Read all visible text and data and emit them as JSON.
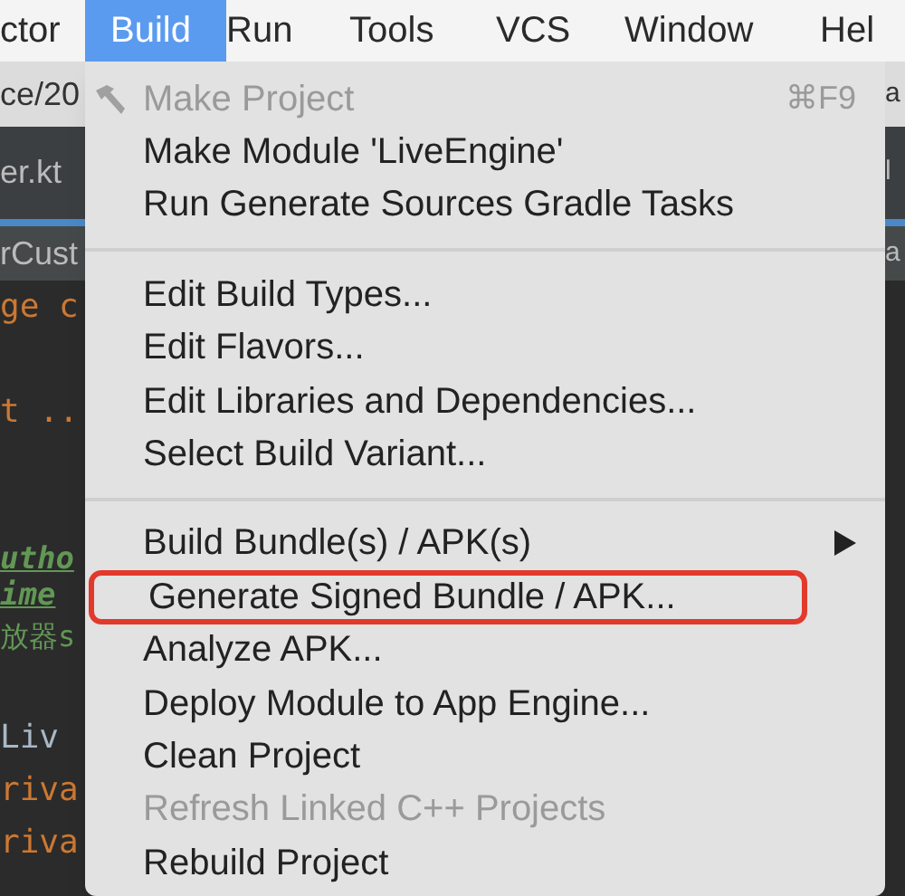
{
  "menu_bar": [
    {
      "label": "ctor",
      "selected": false
    },
    {
      "label": "Build",
      "selected": true
    },
    {
      "label": "Run",
      "selected": false
    },
    {
      "label": "Tools",
      "selected": false
    },
    {
      "label": "VCS",
      "selected": false
    },
    {
      "label": "Window",
      "selected": false
    },
    {
      "label": "Hel",
      "selected": false
    }
  ],
  "editor_left": [
    {
      "kind": "path",
      "text": "ce/20"
    },
    {
      "kind": "tab",
      "text": "er.kt"
    },
    {
      "kind": "tab2",
      "text": "rCust"
    },
    {
      "kind": "keyword",
      "text": "ge c"
    },
    {
      "kind": "blank"
    },
    {
      "kind": "keyword",
      "text": "t .."
    },
    {
      "kind": "blank"
    },
    {
      "kind": "blank"
    },
    {
      "kind": "doc",
      "text": "utho"
    },
    {
      "kind": "doc",
      "text": "ime"
    },
    {
      "kind": "comment",
      "text": "放器s"
    },
    {
      "kind": "blank"
    },
    {
      "kind": "plain",
      "text": "Liv"
    },
    {
      "kind": "keyword",
      "text": "riva"
    },
    {
      "kind": "keyword",
      "text": "riva"
    }
  ],
  "editor_right": [
    {
      "kind": "path",
      "text": "a"
    },
    {
      "kind": "tab",
      "text": "l"
    },
    {
      "kind": "tab2",
      "text": "a"
    }
  ],
  "build_menu": [
    {
      "kind": "item",
      "label": "Make Project",
      "disabled": true,
      "icon": true,
      "shortcut": "⌘F9"
    },
    {
      "kind": "item",
      "label": "Make Module 'LiveEngine'",
      "disabled": false
    },
    {
      "kind": "item",
      "label": "Run Generate Sources Gradle Tasks",
      "disabled": false
    },
    {
      "kind": "separator"
    },
    {
      "kind": "item",
      "label": "Edit Build Types...",
      "disabled": false
    },
    {
      "kind": "item",
      "label": "Edit Flavors...",
      "disabled": false
    },
    {
      "kind": "item",
      "label": "Edit Libraries and Dependencies...",
      "disabled": false
    },
    {
      "kind": "item",
      "label": "Select Build Variant...",
      "disabled": false
    },
    {
      "kind": "separator"
    },
    {
      "kind": "item",
      "label": "Build Bundle(s) / APK(s)",
      "disabled": false,
      "submenu": true
    },
    {
      "kind": "item",
      "label": "Generate Signed Bundle / APK...",
      "disabled": false,
      "outlined": true
    },
    {
      "kind": "item",
      "label": "Analyze APK...",
      "disabled": false
    },
    {
      "kind": "item",
      "label": "Deploy Module to App Engine...",
      "disabled": false
    },
    {
      "kind": "item",
      "label": "Clean Project",
      "disabled": false
    },
    {
      "kind": "item",
      "label": "Refresh Linked C++ Projects",
      "disabled": true
    },
    {
      "kind": "item",
      "label": "Rebuild Project",
      "disabled": false
    }
  ]
}
